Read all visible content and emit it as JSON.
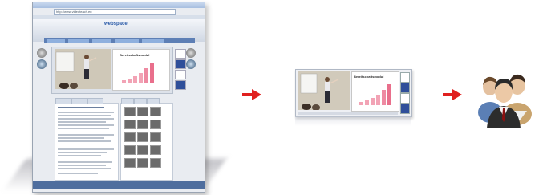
{
  "browser": {
    "address": "http://www.videoteach.eu",
    "logo": "webspace",
    "slide_title": "Bereitschaftsmodul"
  },
  "player": {
    "slide_title": "Bereitschaftsmodul"
  },
  "icons": {
    "arrow_1": "right-arrow",
    "arrow_2": "right-arrow",
    "people": "users-group"
  },
  "colors": {
    "arrow": "#e0201f",
    "chart_bars": "#f2a3b5"
  }
}
